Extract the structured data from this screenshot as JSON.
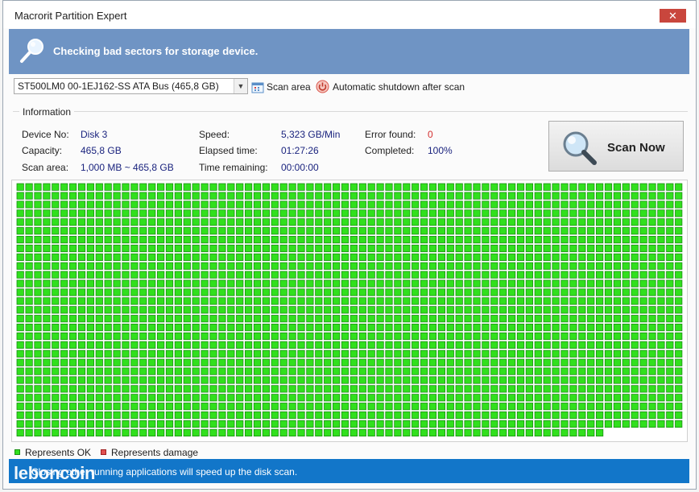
{
  "window": {
    "title": "Macrorit Partition Expert",
    "close_glyph": "✕"
  },
  "header": {
    "text": "Checking bad sectors for storage device.",
    "band_color": "#6f94c4"
  },
  "toolbar": {
    "device": "ST500LM0 00-1EJ162-SS ATA Bus (465,8 GB)",
    "scan_area_label": "Scan area",
    "scan_area_icon": "calendar-icon",
    "shutdown_label": "Automatic shutdown after scan",
    "shutdown_icon": "power-icon"
  },
  "information": {
    "legend": "Information",
    "device_no_label": "Device No:",
    "device_no": "Disk 3",
    "capacity_label": "Capacity:",
    "capacity": "465,8 GB",
    "scan_area_label": "Scan area:",
    "scan_area": "1,000 MB ~ 465,8 GB",
    "speed_label": "Speed:",
    "speed": "5,323 GB/Min",
    "elapsed_label": "Elapsed time:",
    "elapsed": "01:27:26",
    "remaining_label": "Time remaining:",
    "remaining": "00:00:00",
    "errors_label": "Error found:",
    "errors": "0",
    "completed_label": "Completed:",
    "completed": "100%"
  },
  "scan_button": {
    "label": "Scan Now",
    "icon": "magnifier-icon"
  },
  "block_map": {
    "ok_color": "#31e01d",
    "ok_border": "#1a8f12",
    "damage_color": "#e05050",
    "columns": 76,
    "full_rows": 28,
    "last_row_blocks": 67
  },
  "legend": {
    "ok_label": "Represents OK",
    "damage_label": "Represents damage"
  },
  "status": {
    "text": "Closing other running applications will speed up the disk scan.",
    "watermark": "leboncoin"
  }
}
